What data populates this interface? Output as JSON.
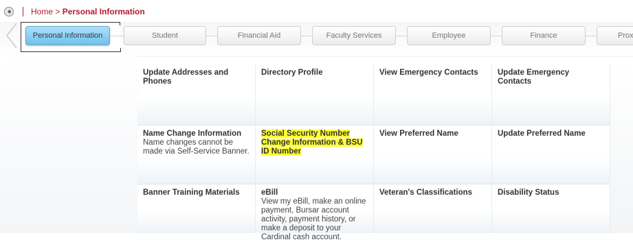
{
  "breadcrumb": {
    "home": "Home",
    "separator": " > ",
    "current": "Personal Information"
  },
  "tabs": [
    {
      "label": "Personal Information",
      "active": true
    },
    {
      "label": "Student"
    },
    {
      "label": "Financial Aid"
    },
    {
      "label": "Faculty Services"
    },
    {
      "label": "Employee"
    },
    {
      "label": "Finance"
    },
    {
      "label": "Proxy"
    }
  ],
  "grid": {
    "rows": [
      [
        {
          "title": "Update Addresses and Phones",
          "desc": ""
        },
        {
          "title": "Directory Profile",
          "desc": ""
        },
        {
          "title": "View Emergency Contacts",
          "desc": ""
        },
        {
          "title": "Update Emergency Contacts",
          "desc": ""
        }
      ],
      [
        {
          "title": "Name Change Information",
          "desc": "Name changes cannot be made via Self-Service Banner."
        },
        {
          "title": "Social Security Number Change Information & BSU ID Number",
          "desc": "",
          "highlighted": true
        },
        {
          "title": "View Preferred Name",
          "desc": ""
        },
        {
          "title": "Update Preferred Name",
          "desc": ""
        }
      ],
      [
        {
          "title": "Banner Training Materials",
          "desc": ""
        },
        {
          "title": "eBill",
          "desc": "View my eBill, make an online payment, Bursar account activity, payment history, or make a deposit to your Cardinal cash account."
        },
        {
          "title": "Veteran's Classifications",
          "desc": ""
        },
        {
          "title": "Disability Status",
          "desc": ""
        }
      ]
    ]
  },
  "colors": {
    "brand_red": "#b01c2e",
    "active_tab": "#6fc1ea",
    "highlight": "#ffff33"
  }
}
